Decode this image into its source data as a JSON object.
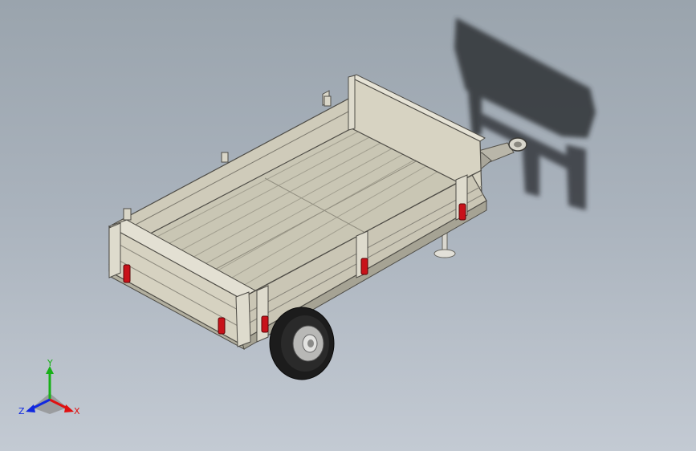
{
  "viewport": {
    "model": "utility-trailer",
    "background_top": "#9aa4ad",
    "background_bottom": "#c3cad3"
  },
  "colors": {
    "frame": "#c6c3b6",
    "panel": "#d4d0bf",
    "floor": "#c9c6b4",
    "latch": "#c8121a",
    "tire": "#1c1c1c",
    "shadow": "#3a3c40"
  },
  "triad": {
    "x_label": "X",
    "y_label": "Y",
    "z_label": "Z",
    "x_color": "#e01010",
    "y_color": "#18b018",
    "z_color": "#1028e0"
  }
}
